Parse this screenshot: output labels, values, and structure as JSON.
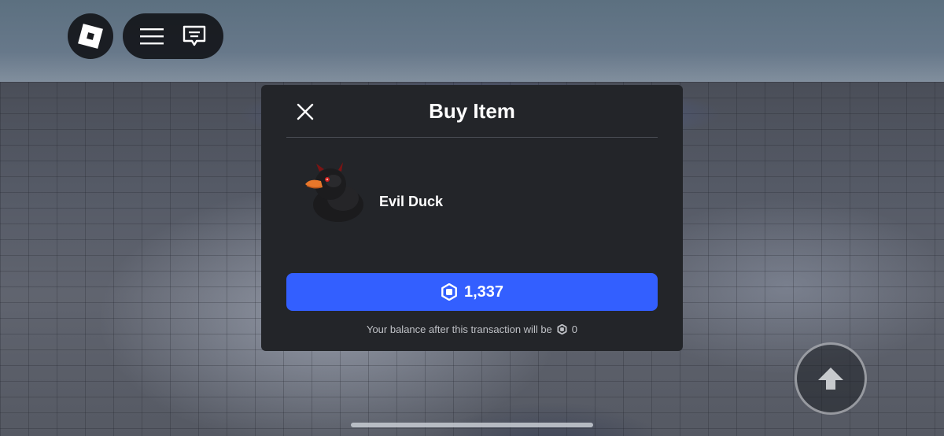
{
  "dialog": {
    "title": "Buy Item",
    "item_name": "Evil Duck",
    "price": "1,337",
    "balance_text": "Your balance after this transaction will be",
    "balance_value": "0"
  },
  "hud": {
    "logo_icon": "roblox-logo-icon",
    "menu_icon": "hamburger-menu-icon",
    "chat_icon": "chat-icon",
    "jump_icon": "jump-arrow-icon"
  },
  "colors": {
    "dialog_bg": "#232529",
    "buy_button": "#335fff",
    "text_primary": "#ffffff",
    "text_secondary": "#bfc1c6"
  }
}
